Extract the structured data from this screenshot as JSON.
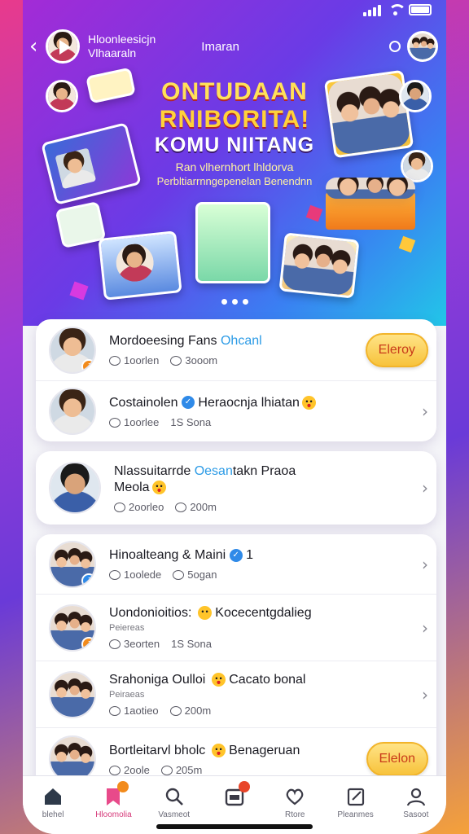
{
  "status": {
    "signal": "signal-icon",
    "wifi": "wifi-icon",
    "battery": "battery-icon"
  },
  "header": {
    "channel_title_line1": "Hloonleesicjn",
    "channel_title_line2": "Vlhaaraln",
    "center_title": "Imaran"
  },
  "hero": {
    "headline_line1": "ONTUDAAN",
    "headline_line2": "RNIBORITA!",
    "headline_line3": "KOMU NIITANG",
    "subtitle_line1": "Ran vlhernhort lhldorva",
    "subtitle_line2": "Perbltiarrnngepenelan Benendnn",
    "carousel_pages": 3,
    "carousel_active": 1
  },
  "groups": [
    {
      "rows": [
        {
          "title": "Mordoeesing Fans ",
          "title_highlight": "Ohcanl",
          "meta1": "1oorlen",
          "meta2": "3ooom",
          "action": "Eleroy",
          "avatar_badge": "orange"
        },
        {
          "title": "Costainolen ",
          "title_after": " Heraocnja lhiatan",
          "meta1": "1oorlee",
          "meta2": "1S Sona",
          "chevron": "›"
        }
      ]
    },
    {
      "rows": [
        {
          "title": "Nlassuitarrde ",
          "title_highlight": "Oesan",
          "title_after": "takn Praoa",
          "title_line2": "Meola",
          "meta1": "2oorleo",
          "meta2": "200m",
          "chevron": "›"
        }
      ]
    },
    {
      "rows": [
        {
          "title": "Hinoalteang & Maini ",
          "title_after": " 1",
          "meta1": "1oolede",
          "meta2": "5ogan",
          "chevron": "›",
          "avatar_badge": "blue"
        },
        {
          "title": "Uondonioitios: ",
          "title_after": " Kocecentgdalieg",
          "sub": "Peiereas",
          "meta1": "3eorten",
          "meta2": "1S Sona",
          "chevron": "›",
          "avatar_badge": "orange"
        },
        {
          "title": "Srahoniga Oulloi ",
          "title_after": " Cacato bonal",
          "sub": "Peiraeas",
          "meta1": "1aotieo",
          "meta2": "200m",
          "chevron": "›"
        },
        {
          "title": "Bortleitarvl bholc ",
          "title_after": " Benageruan",
          "meta1": "2oole",
          "meta2": "205m",
          "action": "Elelon"
        }
      ]
    }
  ],
  "tabbar": {
    "tabs": [
      {
        "label": "blehel",
        "icon": "home-icon"
      },
      {
        "label": "Hloomolia",
        "icon": "bookmark-icon",
        "badge": ""
      },
      {
        "label": "Vasmeot",
        "icon": "search-icon"
      },
      {
        "label": "",
        "icon": "calendar-icon",
        "badge": ""
      },
      {
        "label": "Rtore",
        "icon": "heart-icon"
      },
      {
        "label": "Pleanmes",
        "icon": "edit-icon"
      },
      {
        "label": "Sasoot",
        "icon": "profile-icon"
      }
    ],
    "active_index": 1
  },
  "colors": {
    "accent": "#d63a7a",
    "highlight": "#2c9be6",
    "button": "#f7c33c",
    "button_text": "#c83a1a"
  }
}
